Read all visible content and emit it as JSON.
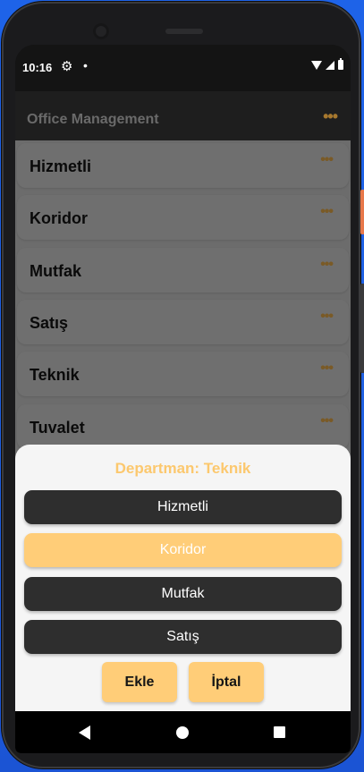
{
  "status": {
    "time": "10:16",
    "gear_icon": "⚙",
    "dot_icon": "•"
  },
  "appbar": {
    "title": "Office Management",
    "menu_icon": "•••"
  },
  "list": {
    "dots": "•••",
    "items": [
      {
        "label": "Hizmetli"
      },
      {
        "label": "Koridor"
      },
      {
        "label": "Mutfak"
      },
      {
        "label": "Satış"
      },
      {
        "label": "Teknik"
      },
      {
        "label": "Tuvalet"
      }
    ]
  },
  "sheet": {
    "title": "Departman: Teknik",
    "options": [
      {
        "label": "Hizmetli",
        "selected": false
      },
      {
        "label": "Koridor",
        "selected": true
      },
      {
        "label": "Mutfak",
        "selected": false
      },
      {
        "label": "Satış",
        "selected": false
      }
    ],
    "add_label": "Ekle",
    "cancel_label": "İptal"
  },
  "colors": {
    "accent": "#ffcd78",
    "title_accent": "#fcc86e",
    "option_bg": "#2e2e2e"
  }
}
